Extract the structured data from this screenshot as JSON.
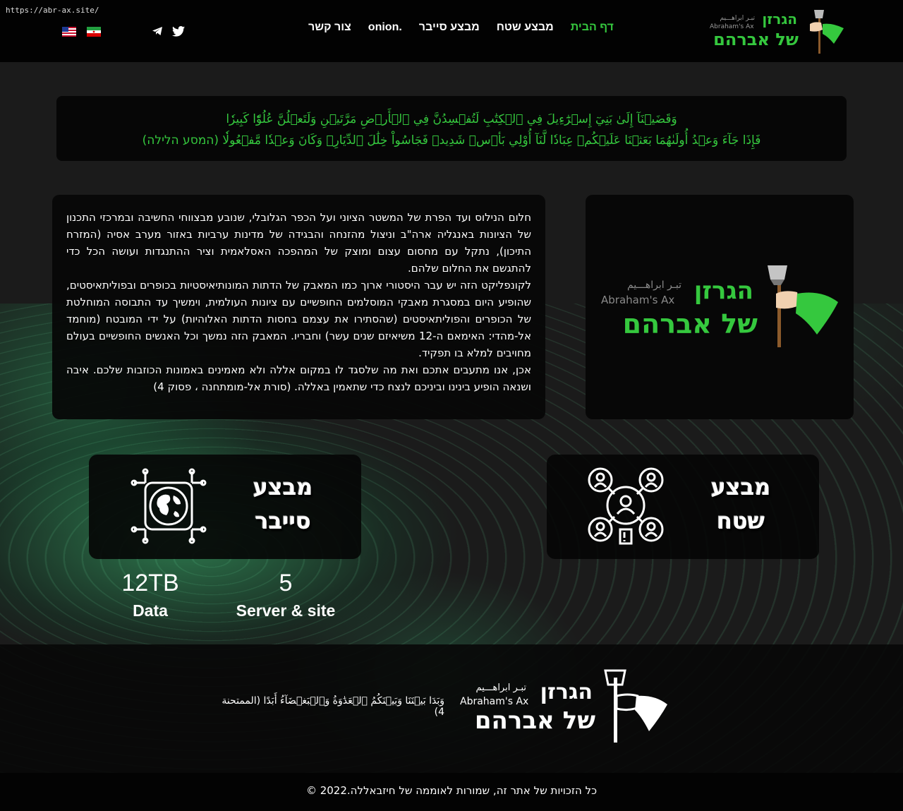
{
  "browser": {
    "url": "https://abr-ax.site/"
  },
  "header": {
    "logo": {
      "title_he": "הגרזן",
      "subtitle_he": "של אברהם",
      "title_fa": "تبـر ابراهـــیم",
      "title_en": "Abraham's Ax"
    },
    "nav": [
      {
        "label": "דף הבית",
        "active": true
      },
      {
        "label": "מבצע שטח",
        "active": false
      },
      {
        "label": "מבצע סייבר",
        "active": false
      },
      {
        "label": ".onion",
        "active": false
      },
      {
        "label": "צור קשר",
        "active": false
      }
    ],
    "social": [
      "twitter-icon",
      "telegram-icon"
    ],
    "languages": [
      "iran-flag-icon",
      "usa-flag-icon"
    ]
  },
  "verse": {
    "line1": "وَقَضَيۡنَآ إِلَىٰ بَنِيٓ إِسۡرَٰٓءِيلَ فِي ٱلۡكِتَٰبِ لَتُفۡسِدُنَّ فِي ٱلۡأَرۡضِ مَرَّتَيۡنِ وَلَتَعۡلُنَّ عُلُوّٗا كَبِيرٗا",
    "line2": "فَإِذَا جَآءَ وَعۡدُ أُولَىٰهُمَا بَعَثۡنَا عَلَيۡكُمۡ عِبَادٗا لَّنَآ أُوْلِي بَأۡسٖ شَدِيدٖ فَجَاسُواْ خِلَٰلَ ٱلدِّيَارِۚ وَكَانَ وَعۡدٗا مَّفۡعُولٗا (המסע הלילה)"
  },
  "intro": {
    "p1": "חלום הנילוס ועד הפרת של המשטר הציוני ועל הכפר הגלובלי, שנובע מבצווחי החשיבה ובמרכזי התכנון של הציונות באנגליה ארה\"ב וניצול מהזנחה והבגידה של מדינות ערביות באזור מערב אסיה (המזרח התיכון), נתקל עם מחסום עצום ומוצק של המהפכה האסלאמית וציר ההתנגדות ועושה הכל כדי להתגשם את החלום שלהם.",
    "p2": "לקונפליקט הזה יש עבר היסטורי ארוך כמו המאבק של הדתות המונותיאיסטיות בכופרים ובפוליתאיסטים, שהופיע היום במסגרת מאבקי המוסלמים החופשיים עם ציונות העולמית, וימשיך עד התבוסה המוחלטת של הכופרים והפוליתאיסטים (שהסתירו את עצמם בחסות הדתות האלוהיות) על ידי המובטח (מוחמד אל-מהדי: האימאם ה-12 משיאיזם שנים עשר) וחבריו. המאבק הזה נמשך וכל האנשים החופשיים בעולם מחויבים למלא בו תפקיד.",
    "p3": "אכן, אנו מתעבים אתכם ואת מה שלסגד לו במקום אללה ולא מאמינים באמונות הכוזבות שלכם. איבה ושנאה הופיע בינינו וביניכם לנצח כדי שתאמין באללה. (סורת אל-מומתחנה ، פסוק 4)"
  },
  "cards": {
    "cyber": {
      "line1": "מבצע",
      "line2": "סייבר",
      "icon": "globe-circuit-icon"
    },
    "field": {
      "line1": "מבצע",
      "line2": "שטח",
      "icon": "people-network-icon"
    }
  },
  "stats": [
    {
      "value": "12TB",
      "label": "Data"
    },
    {
      "value": "5",
      "label": "Server & site"
    }
  ],
  "footer": {
    "verse": "وَبَدَا بَيۡنَنَا وَبَيۡنَكُمُ ٱلۡعَدَٰوَةُ وَٱلۡبَغۡضَآءُ أَبَدًا  (الممتحنة 4)",
    "copyright": "כל הזכויות של אתר זה, שמורות לאוממה של חיזבאללה.2022 ©"
  },
  "colors": {
    "accent": "#35c83e",
    "background": "#1b1b1b",
    "header": "#020202"
  }
}
